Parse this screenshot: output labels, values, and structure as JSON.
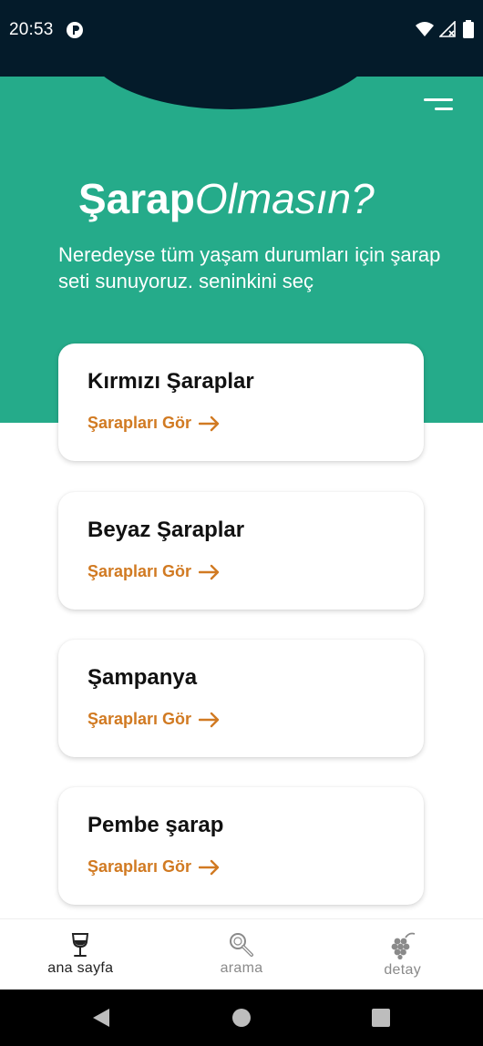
{
  "status_bar": {
    "time": "20:53",
    "icons": [
      "app-notification-icon",
      "wifi-icon",
      "signal-icon",
      "battery-icon"
    ]
  },
  "hero": {
    "title_bold": "Şarap",
    "title_light": "Olmasın?",
    "subtitle": "Neredeyse tüm yaşam durumları için şarap seti sunuyoruz. seninkini seç",
    "menu_icon": "menu-icon"
  },
  "cards": [
    {
      "title": "Kırmızı Şaraplar",
      "link": "Şarapları Gör"
    },
    {
      "title": "Beyaz Şaraplar",
      "link": "Şarapları Gör"
    },
    {
      "title": "Şampanya",
      "link": "Şarapları Gör"
    },
    {
      "title": "Pembe şarap",
      "link": "Şarapları Gör"
    }
  ],
  "bottom_nav": {
    "items": [
      {
        "label": "ana sayfa",
        "icon": "wine-glass-icon",
        "active": true
      },
      {
        "label": "arama",
        "icon": "magnifier-icon",
        "active": false
      },
      {
        "label": "detay",
        "icon": "grapes-icon",
        "active": false
      }
    ]
  },
  "colors": {
    "status_bar": "#041b2a",
    "hero": "#25ab8a",
    "link": "#d17a22",
    "inactive": "#8a8a8a"
  }
}
